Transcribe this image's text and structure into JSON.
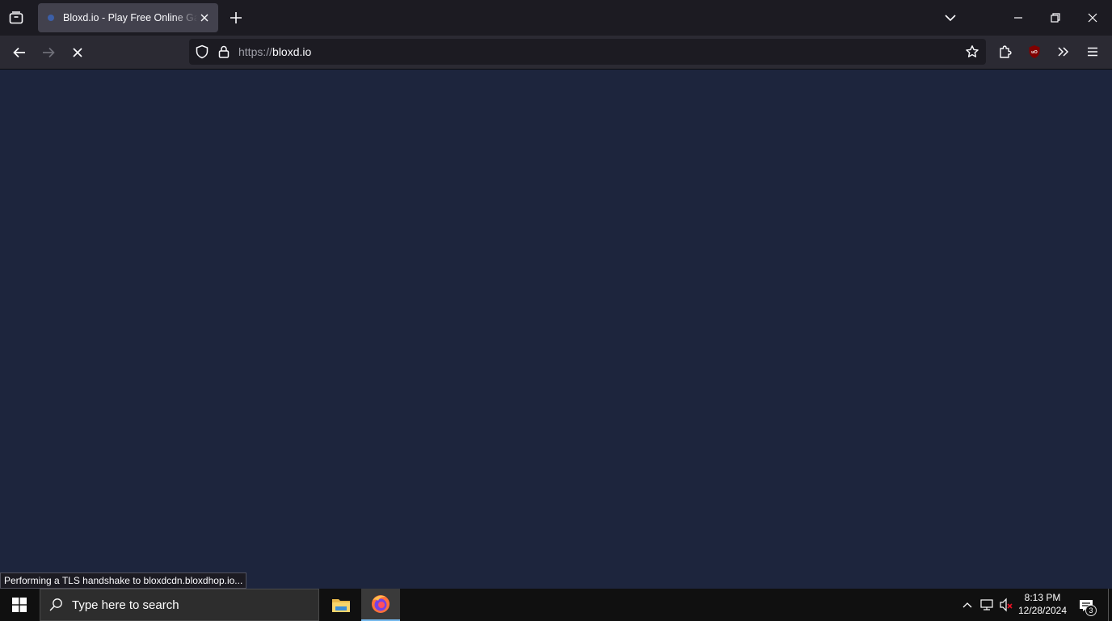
{
  "browser": {
    "tab": {
      "title": "Bloxd.io - Play Free Online Games",
      "favicon_color": "#3c5fa8"
    },
    "url": {
      "scheme": "https://",
      "host": "bloxd.io"
    },
    "status_text": "Performing a TLS handshake to bloxdcdn.bloxdhop.io...",
    "icons": [
      "tab-list-icon",
      "close-tab-icon",
      "new-tab-icon",
      "list-all-tabs-icon",
      "minimize-icon",
      "restore-icon",
      "close-window-icon",
      "back-icon",
      "forward-icon",
      "stop-loading-icon",
      "shield-icon",
      "lock-icon",
      "bookmark-star-icon",
      "extensions-icon",
      "ublock-origin-icon",
      "overflow-menu-icon",
      "hamburger-menu-icon"
    ]
  },
  "page": {
    "background_color": "#1d253d"
  },
  "taskbar": {
    "search_placeholder": "Type here to search",
    "apps": [
      "file-explorer-icon",
      "firefox-icon"
    ],
    "clock_time": "8:13 PM",
    "clock_date": "12/28/2024",
    "notification_count": "3"
  }
}
